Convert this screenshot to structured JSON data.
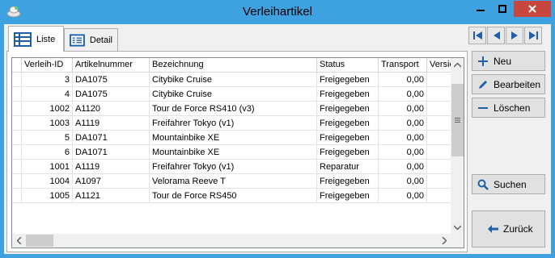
{
  "window": {
    "title": "Verleihartikel",
    "colors": {
      "titlebar": "#3ea2e0",
      "close": "#c7463d",
      "accent_icon": "#1f5fa8"
    }
  },
  "tabs": [
    {
      "label": "Liste",
      "icon": "table-icon",
      "active": true
    },
    {
      "label": "Detail",
      "icon": "form-icon",
      "active": false
    }
  ],
  "table": {
    "columns": [
      "",
      "Verleih-ID",
      "Artikelnummer",
      "Bezeichnung",
      "Status",
      "Transport",
      "Versich"
    ],
    "rows": [
      [
        "3",
        "DA1075",
        "Citybike Cruise",
        "Freigegeben",
        "0,00"
      ],
      [
        "4",
        "DA1075",
        "Citybike Cruise",
        "Freigegeben",
        "0,00"
      ],
      [
        "1002",
        "A1120",
        "Tour de Force RS410 (v3)",
        "Freigegeben",
        "0,00"
      ],
      [
        "1003",
        "A1119",
        "Freifahrer Tokyo (v1)",
        "Freigegeben",
        "0,00"
      ],
      [
        "5",
        "DA1071",
        "Mountainbike XE",
        "Freigegeben",
        "0,00"
      ],
      [
        "6",
        "DA1071",
        "Mountainbike XE",
        "Freigegeben",
        "0,00"
      ],
      [
        "1001",
        "A1119",
        "Freifahrer Tokyo (v1)",
        "Reparatur",
        "0,00"
      ],
      [
        "1004",
        "A1097",
        "Velorama Reeve T",
        "Freigegeben",
        "0,00"
      ],
      [
        "1005",
        "A1121",
        "Tour de Force RS450",
        "Freigegeben",
        "0,00"
      ]
    ]
  },
  "nav": [
    "first-icon",
    "prev-icon",
    "next-icon",
    "last-icon"
  ],
  "actions": {
    "new": "Neu",
    "edit": "Bearbeiten",
    "delete": "Löschen",
    "search": "Suchen",
    "back": "Zurück"
  }
}
